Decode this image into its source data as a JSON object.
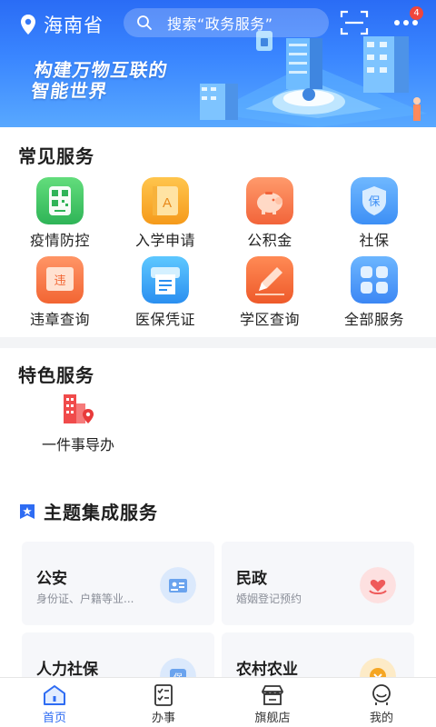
{
  "header": {
    "location": "海南省",
    "search_placeholder": "搜索“政务服务”",
    "notification_count": "4",
    "banner_title_line1": "构建万物互联的",
    "banner_title_line2": "智能世界"
  },
  "common_services": {
    "title": "常见服务",
    "items": [
      {
        "label": "疫情防控",
        "icon": "qr-code-icon"
      },
      {
        "label": "入学申请",
        "icon": "book-icon"
      },
      {
        "label": "公积金",
        "icon": "piggy-bank-icon"
      },
      {
        "label": "社保",
        "icon": "insurance-shield-icon"
      },
      {
        "label": "违章查询",
        "icon": "traffic-ticket-icon"
      },
      {
        "label": "医保凭证",
        "icon": "receipt-icon"
      },
      {
        "label": "学区查询",
        "icon": "pencil-icon"
      },
      {
        "label": "全部服务",
        "icon": "grid-icon"
      }
    ]
  },
  "featured_services": {
    "title": "特色服务",
    "items": [
      {
        "label": "一件事导办",
        "icon": "building-location-icon"
      }
    ]
  },
  "topic_services": {
    "title": "主题集成服务",
    "cards": [
      {
        "title": "公安",
        "subtitle": "身份证、户籍等业...",
        "icon": "id-card-icon"
      },
      {
        "title": "民政",
        "subtitle": "婚姻登记预约",
        "icon": "heart-hands-icon"
      },
      {
        "title": "人力社保",
        "subtitle": "",
        "icon": "insurance-icon"
      },
      {
        "title": "农村农业",
        "subtitle": "",
        "icon": "farm-icon"
      }
    ]
  },
  "tabbar": {
    "active": "首页",
    "tabs": [
      {
        "label": "首页",
        "icon": "home-icon"
      },
      {
        "label": "办事",
        "icon": "checklist-icon"
      },
      {
        "label": "旗舰店",
        "icon": "store-icon"
      },
      {
        "label": "我的",
        "icon": "profile-icon"
      }
    ]
  },
  "colors": {
    "brand_blue": "#2e6cf3",
    "badge_red": "#f0463c",
    "green": "#3fbf62",
    "orange": "#f5a623",
    "coral": "#f26a3f",
    "sky": "#4a9cf6"
  }
}
